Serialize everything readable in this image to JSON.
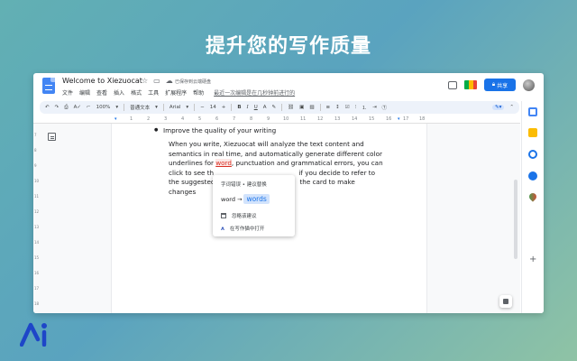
{
  "headline": "提升您的写作质量",
  "header": {
    "doc_title": "Welcome to Xiezuocat",
    "save_status": "已保存到云端硬盘",
    "menu": [
      "文件",
      "编辑",
      "查看",
      "插入",
      "格式",
      "工具",
      "扩展程序",
      "帮助"
    ],
    "last_edit": "最近一次编辑是在几秒钟前进行的",
    "share_label": "共享"
  },
  "toolbar": {
    "zoom": "100%",
    "style": "普通文本",
    "font": "Arial",
    "font_size": "14",
    "bold": "B",
    "italic": "I",
    "underline": "U",
    "text_color": "A"
  },
  "ruler": [
    "1",
    "2",
    "3",
    "4",
    "5",
    "6",
    "7",
    "8",
    "9",
    "10",
    "11",
    "12",
    "13",
    "14",
    "15",
    "16",
    "17",
    "18"
  ],
  "vruler": [
    "7",
    "8",
    "9",
    "10",
    "11",
    "12",
    "13",
    "14",
    "15",
    "16",
    "17",
    "18"
  ],
  "document": {
    "bullet": "Improve the quality of your writing",
    "para_before": "When you write, Xiezuocat will analyze the text content and semantics in real time, and automatically generate different color underlines for ",
    "error_word": "word",
    "para_after": ", punctuation and grammatical errors, you can click to see th",
    "para_line5_a": "if you decide to refer to",
    "para_line6_a": "the suggested",
    "para_line6_b": "the card to make",
    "para_line7": "changes"
  },
  "card": {
    "header": "字词错误 • 建议替换",
    "original": "word",
    "arrow": "→",
    "suggestion": "words",
    "ignore_label": "忽略该建议",
    "open_label": "在写作猫中打开"
  },
  "colors": {
    "accent": "#1a73e8",
    "error": "#d93025",
    "brand": "#2b4fb8"
  }
}
